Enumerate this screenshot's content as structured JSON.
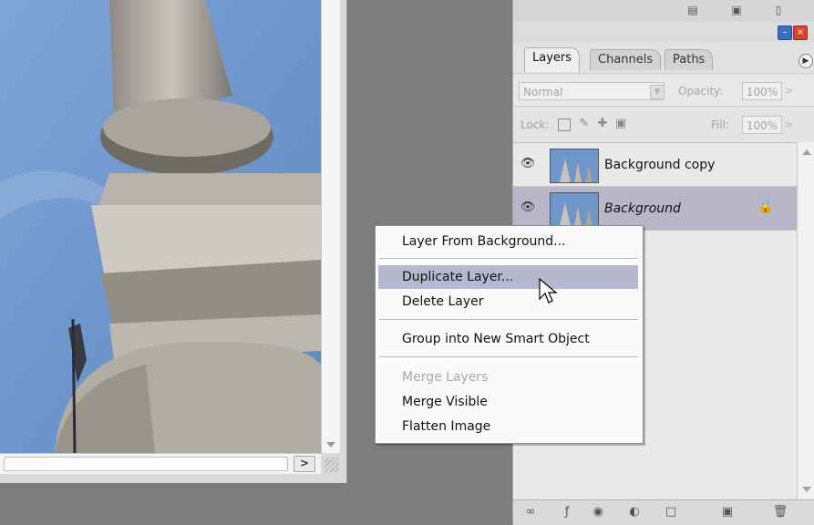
{
  "panel": {
    "tabs": [
      {
        "label": "Layers",
        "active": true
      },
      {
        "label": "Channels",
        "active": false
      },
      {
        "label": "Paths",
        "active": false
      }
    ],
    "blend_mode": "Normal",
    "opacity_label": "Opacity:",
    "opacity_value": "100%",
    "lock_label": "Lock:",
    "fill_label": "Fill:",
    "fill_value": "100%",
    "layers": [
      {
        "name": "Background copy",
        "visible": true,
        "selected": false,
        "locked": false
      },
      {
        "name": "Background",
        "visible": true,
        "selected": true,
        "locked": true
      }
    ],
    "bottom_icons": [
      "link-icon",
      "layer-style-icon",
      "mask-icon",
      "adjustment-icon",
      "group-folder-icon",
      "new-layer-icon",
      "trash-icon"
    ]
  },
  "context_menu": {
    "items": [
      {
        "label": "Layer From Background...",
        "enabled": true
      },
      {
        "label": "Duplicate Layer...",
        "enabled": true,
        "highlighted": true
      },
      {
        "label": "Delete Layer",
        "enabled": true
      },
      {
        "label": "Group into New Smart Object",
        "enabled": true
      },
      {
        "label": "Merge Layers",
        "enabled": false
      },
      {
        "label": "Merge Visible",
        "enabled": true
      },
      {
        "label": "Flatten Image",
        "enabled": true
      }
    ]
  },
  "colors": {
    "workspace": "#7d7d7d",
    "selection": "#b7b7c9",
    "menu_highlight": "#b7b8d0",
    "sky": "#6f95c9"
  }
}
